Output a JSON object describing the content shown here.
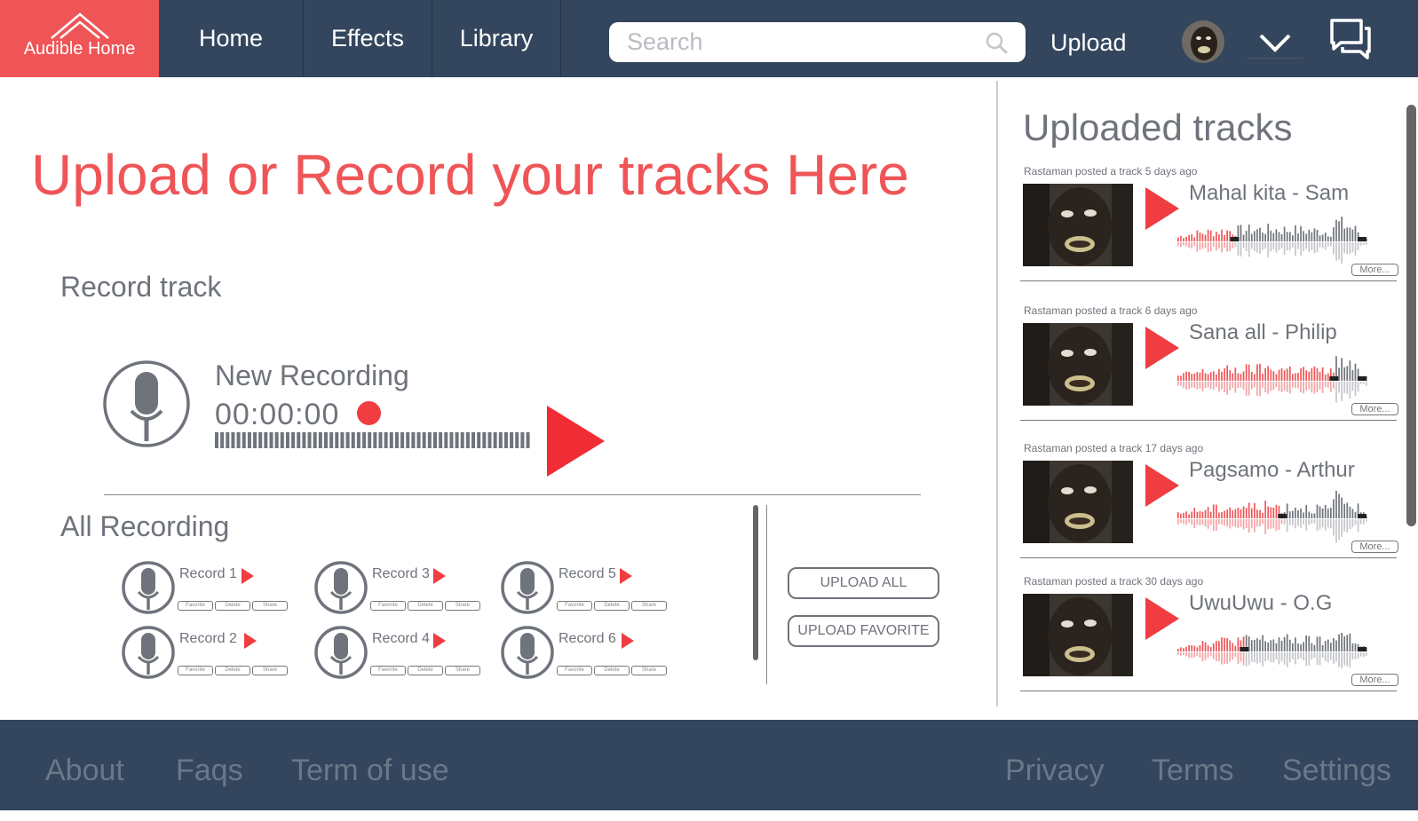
{
  "header": {
    "logo_text": "Audible Home",
    "nav": {
      "home": "Home",
      "effects": "Effects",
      "library": "Library"
    },
    "search_placeholder": "Search",
    "upload_label": "Upload"
  },
  "main": {
    "title": "Upload or Record your tracks Here",
    "record_track_title": "Record track",
    "new_recording_label": "New Recording",
    "timer": "00:00:00",
    "all_recording_title": "All Recording",
    "records": [
      {
        "name": "Record 1"
      },
      {
        "name": "Record 2"
      },
      {
        "name": "Record 3"
      },
      {
        "name": "Record 4"
      },
      {
        "name": "Record 5"
      },
      {
        "name": "Record 6"
      }
    ],
    "record_actions": {
      "favorite": "Favorite",
      "delete": "Delete",
      "share": "Share"
    },
    "upload_all_label": "UPLOAD ALL",
    "upload_favorite_label": "UPLOAD FAVORITE"
  },
  "panel": {
    "title": "Uploaded tracks",
    "more_label": "More...",
    "tracks": [
      {
        "posted": "Rastaman posted a track 5 days ago",
        "title": "Mahal kita - Sam",
        "progress": 0.3
      },
      {
        "posted": "Rastaman posted a track 6 days ago",
        "title": "Sana all - Philip",
        "progress": 0.82
      },
      {
        "posted": "Rastaman posted a track 17 days ago",
        "title": "Pagsamo - Arthur",
        "progress": 0.55
      },
      {
        "posted": "Rastaman posted a track 30 days ago",
        "title": "UwuUwu - O.G",
        "progress": 0.35
      }
    ]
  },
  "footer": {
    "about": "About",
    "faqs": "Faqs",
    "terms_of_use": "Term of use",
    "privacy": "Privacy",
    "terms": "Terms",
    "settings": "Settings"
  },
  "colors": {
    "header_bg": "#33465d",
    "accent": "#ef5557",
    "play_red": "#ef3d42",
    "text_gray": "#6f737b",
    "wave_gray": "#a7aab0"
  },
  "icons": [
    "home-roof-icon",
    "search-icon",
    "chevron-down-icon",
    "chat-icon",
    "microphone-icon",
    "play-icon",
    "record-dot-icon"
  ]
}
